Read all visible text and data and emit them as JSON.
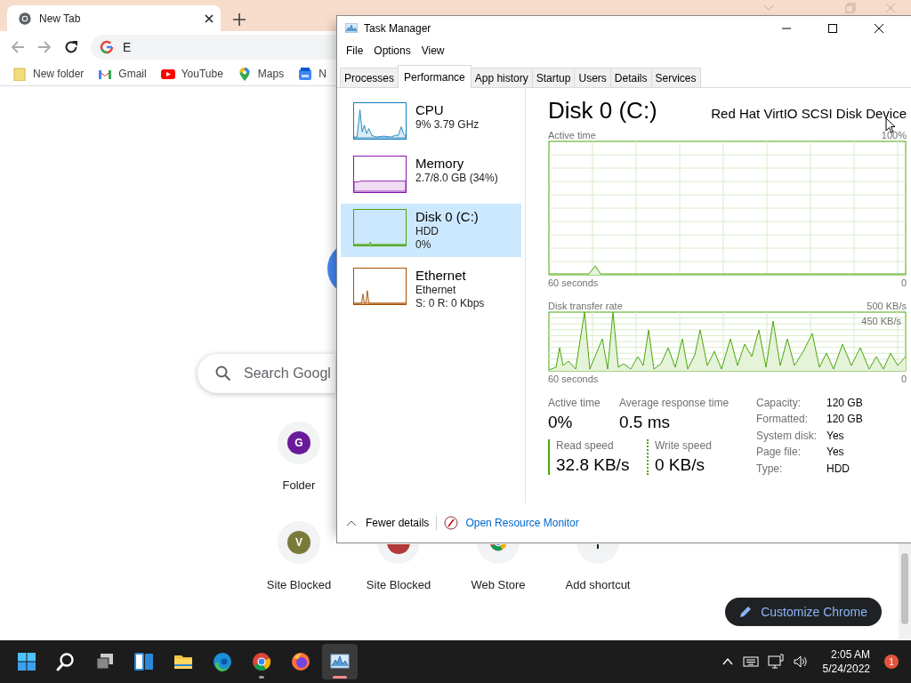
{
  "browser": {
    "tab": {
      "title": "New Tab"
    },
    "address": {
      "value": "E"
    },
    "bookmarks": [
      {
        "label": "New folder",
        "kind": "folder"
      },
      {
        "label": "Gmail",
        "kind": "gmail"
      },
      {
        "label": "YouTube",
        "kind": "youtube"
      },
      {
        "label": "Maps",
        "kind": "maps"
      },
      {
        "label": "N",
        "kind": "news"
      }
    ],
    "search": {
      "placeholder": "Search Googl"
    },
    "shortcuts": [
      {
        "label": "Folder",
        "kind": "letter",
        "letter": "G",
        "color": "#6a1b9a"
      },
      {
        "label": "Site Blocked",
        "kind": "letter",
        "letter": "V",
        "color": "#7a7a3a"
      },
      {
        "label": "Site Blocked",
        "kind": "blank",
        "color": "#b23a3a"
      },
      {
        "label": "Web Store",
        "kind": "store"
      },
      {
        "label": "Add shortcut",
        "kind": "add"
      }
    ],
    "customize": "Customize Chrome"
  },
  "task_manager": {
    "title": "Task Manager",
    "menu": [
      "File",
      "Options",
      "View"
    ],
    "tabs": [
      {
        "label": "Processes",
        "selected": false
      },
      {
        "label": "Performance",
        "selected": true
      },
      {
        "label": "App history",
        "selected": false
      },
      {
        "label": "Startup",
        "selected": false
      },
      {
        "label": "Users",
        "selected": false
      },
      {
        "label": "Details",
        "selected": false
      },
      {
        "label": "Services",
        "selected": false
      }
    ],
    "resources": [
      {
        "kind": "cpu",
        "name": "CPU",
        "lines": [
          "9%  3.79 GHz"
        ],
        "color": "#117dbb",
        "selected": false
      },
      {
        "kind": "memory",
        "name": "Memory",
        "lines": [
          "2.7/8.0 GB (34%)"
        ],
        "color": "#8b12ae",
        "selected": false
      },
      {
        "kind": "disk",
        "name": "Disk 0 (C:)",
        "lines": [
          "HDD",
          "0%"
        ],
        "color": "#4da60c",
        "selected": true
      },
      {
        "kind": "ethernet",
        "name": "Ethernet",
        "lines": [
          "Ethernet",
          "S: 0 R: 0 Kbps"
        ],
        "color": "#a74f01",
        "selected": false
      }
    ],
    "detail": {
      "title": "Disk 0 (C:)",
      "device": "Red Hat VirtIO SCSI Disk Device",
      "graphs": [
        {
          "kind": "active",
          "label": "Active time",
          "max": "100%",
          "span": "60 seconds",
          "min": "0"
        },
        {
          "kind": "transfer",
          "label": "Disk transfer rate",
          "max": "500 KB/s",
          "marker": "450 KB/s",
          "span": "60 seconds",
          "min": "0"
        }
      ],
      "stats": [
        {
          "label": "Active time",
          "value": "0%"
        },
        {
          "label": "Average response time",
          "value": "0.5 ms"
        }
      ],
      "speeds": [
        {
          "kind": "read",
          "label": "Read speed",
          "value": "32.8 KB/s"
        },
        {
          "kind": "write",
          "label": "Write speed",
          "value": "0 KB/s"
        }
      ],
      "properties": [
        {
          "label": "Capacity:",
          "value": "120 GB"
        },
        {
          "label": "Formatted:",
          "value": "120 GB"
        },
        {
          "label": "System disk:",
          "value": "Yes"
        },
        {
          "label": "Page file:",
          "value": "Yes"
        },
        {
          "label": "Type:",
          "value": "HDD"
        }
      ]
    },
    "footer": {
      "fewer": "Fewer details",
      "link": "Open Resource Monitor"
    }
  },
  "taskbar": {
    "apps": [
      {
        "kind": "start",
        "running": false,
        "active": false
      },
      {
        "kind": "search",
        "running": false,
        "active": false
      },
      {
        "kind": "taskview",
        "running": false,
        "active": false
      },
      {
        "kind": "widgets",
        "running": false,
        "active": false
      },
      {
        "kind": "explorer",
        "running": false,
        "active": false
      },
      {
        "kind": "edge",
        "running": false,
        "active": false
      },
      {
        "kind": "chrome",
        "running": true,
        "active": false
      },
      {
        "kind": "firefox",
        "running": false,
        "active": false
      },
      {
        "kind": "taskmgr",
        "running": true,
        "active": true
      }
    ],
    "time": "2:05 AM",
    "date": "5/24/2022",
    "notifications": "1"
  }
}
